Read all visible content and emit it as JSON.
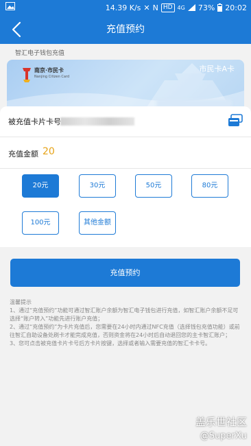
{
  "status_bar": {
    "speed": "14.39 K/s",
    "hd": "HD",
    "network": "4G",
    "battery": "73%",
    "time": "20:02"
  },
  "nav": {
    "title": "充值预约"
  },
  "section_label": "智汇电子钱包充值",
  "card": {
    "logo_cn": "南京·市民卡",
    "logo_en": "Nanjing Citizen Card",
    "type": "市民卡A卡"
  },
  "form": {
    "card_label": "被充值卡片卡号",
    "amount_label": "充值金额",
    "amount_value": "20"
  },
  "options": [
    "20元",
    "30元",
    "50元",
    "80元",
    "100元",
    "其他金额"
  ],
  "selected_option": "20元",
  "submit_label": "充值预约",
  "tips": [
    "温馨提示",
    "1、通过“充值预约”功能可通过智汇账户余额为智汇电子钱包进行充值，如智汇账户余额不足可选择“账户转入”功能先进行账户充值；",
    "2、通过“充值预约”为卡片充值后，您需要在24小时内通过NFC充值（选择钱包充值功能）或前往智汇自助设备处刷卡才能完成充值，否则资金将在24小时后自动退回您的主卡智汇账户；",
    "3、您可点击被充值卡片卡号后方卡片按键，选择或者输入需要充值的智汇卡卡号。"
  ],
  "watermark": {
    "line1": "盖乐世社区",
    "line2": "@SuperXu"
  },
  "colors": {
    "primary": "#1d7ad6",
    "amount": "#e6a317"
  }
}
